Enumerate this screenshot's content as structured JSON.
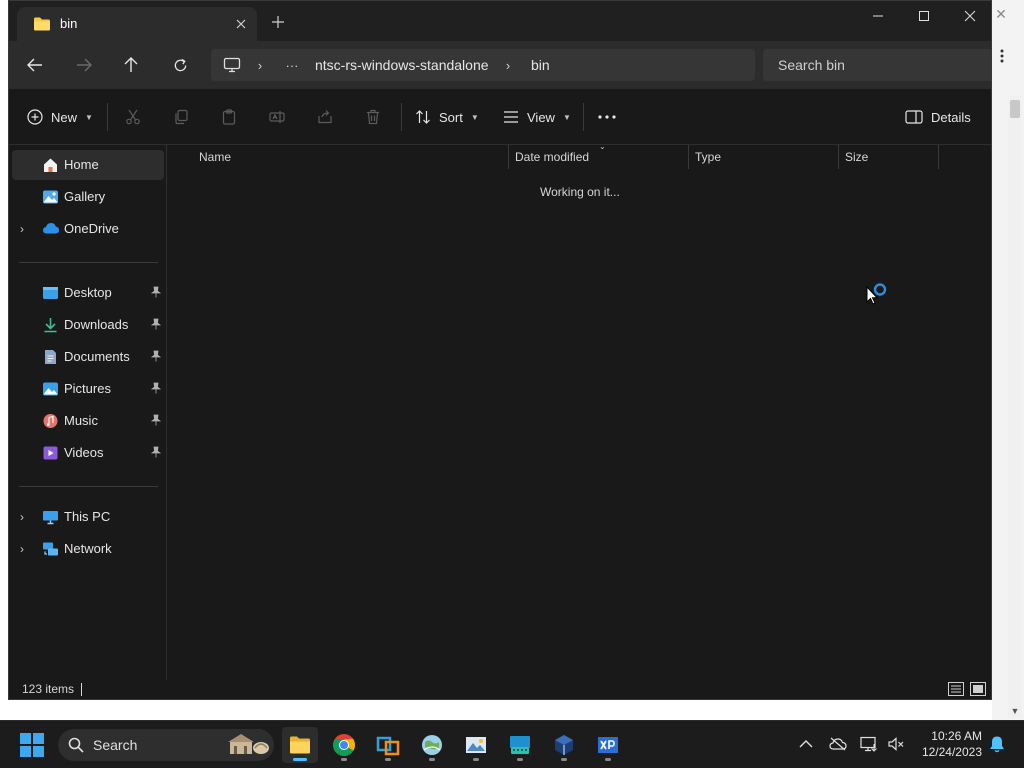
{
  "window": {
    "tab_title": "bin",
    "tab_icon": "folder-icon",
    "controls": {
      "minimize": "minimize-icon",
      "maximize": "maximize-icon",
      "close": "close-icon"
    }
  },
  "navigation": {
    "path": [
      "ntsc-rs-windows-standalone",
      "bin"
    ],
    "path_overflow": "···",
    "search_placeholder": "Search bin"
  },
  "toolbar": {
    "new_label": "New",
    "sort_label": "Sort",
    "view_label": "View",
    "more": "···",
    "details_label": "Details"
  },
  "sidebar": {
    "quick": [
      {
        "label": "Home",
        "icon": "home-icon",
        "selected": true
      },
      {
        "label": "Gallery",
        "icon": "gallery-icon"
      },
      {
        "label": "OneDrive",
        "icon": "cloud-icon",
        "expandable": true
      }
    ],
    "pinned": [
      {
        "label": "Desktop",
        "icon": "desktop-icon",
        "pinned": true
      },
      {
        "label": "Downloads",
        "icon": "download-icon",
        "pinned": true
      },
      {
        "label": "Documents",
        "icon": "document-icon",
        "pinned": true
      },
      {
        "label": "Pictures",
        "icon": "pictures-icon",
        "pinned": true
      },
      {
        "label": "Music",
        "icon": "music-icon",
        "pinned": true
      },
      {
        "label": "Videos",
        "icon": "videos-icon",
        "pinned": true
      }
    ],
    "devices": [
      {
        "label": "This PC",
        "icon": "pc-icon",
        "expandable": true
      },
      {
        "label": "Network",
        "icon": "network-icon",
        "expandable": true
      }
    ]
  },
  "file_list": {
    "columns": [
      "Name",
      "Date modified",
      "Type",
      "Size"
    ],
    "sorted_by": "Date modified",
    "loading_text": "Working on it..."
  },
  "statusbar": {
    "item_count": "123 items"
  },
  "taskbar": {
    "search_label": "Search",
    "apps": [
      "file-explorer-icon",
      "chrome-icon",
      "virtualization-app-icon",
      "globe-app-icon",
      "image-app-icon",
      "keyboard-app-icon",
      "virtualbox-icon",
      "xp-app-icon"
    ],
    "time": "10:26 AM",
    "date": "12/24/2023"
  },
  "colors": {
    "window_bg": "#191919",
    "chrome_bg": "#202020",
    "accent": "#4cc2ff",
    "folder": "#f7c948"
  }
}
